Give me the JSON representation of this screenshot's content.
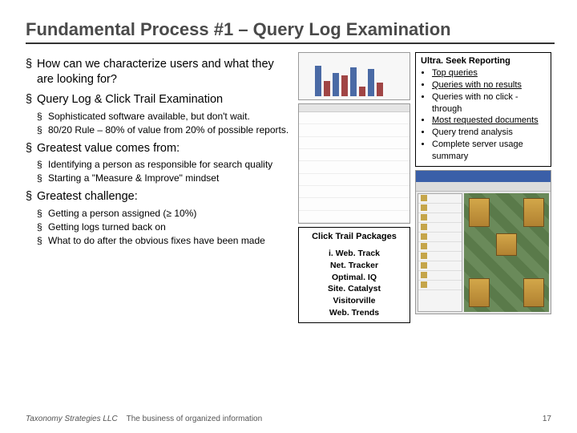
{
  "title": "Fundamental Process #1 – Query Log Examination",
  "left": {
    "q1": "How can we characterize users and what they are looking for?",
    "q2": "Query Log & Click Trail Examination",
    "q2a": "Sophisticated software available, but don't wait.",
    "q2b": "80/20 Rule – 80% of value from 20% of possible reports.",
    "q3": "Greatest value comes from:",
    "q3a": "Identifying a person as responsible for search quality",
    "q3b": "Starting a \"Measure & Improve\" mindset",
    "q4": "Greatest challenge:",
    "q4a": "Getting a person assigned (≥ 10%)",
    "q4b": "Getting logs turned back on",
    "q4c": "What to do after the obvious fixes have been made"
  },
  "ultra": {
    "hdr": "Ultra. Seek Reporting",
    "i1": "Top queries",
    "i2": "Queries with no results",
    "i3": "Queries with no click -through",
    "i4": "Most requested documents",
    "i5": "Query trend analysis",
    "i6": "Complete server usage summary"
  },
  "click": {
    "hdr": "Click Trail Packages",
    "i1": "i. Web. Track",
    "i2": "Net. Tracker",
    "i3": "Optimal. IQ",
    "i4": "Site. Catalyst",
    "i5": "Visitorville",
    "i6": "Web. Trends"
  },
  "footer": {
    "brand": "Taxonomy Strategies LLC",
    "tag": "The business of organized information",
    "page": "17"
  },
  "chart_data": {
    "type": "bar",
    "note": "decorative thumbnail, values not readable",
    "bars": 10
  }
}
